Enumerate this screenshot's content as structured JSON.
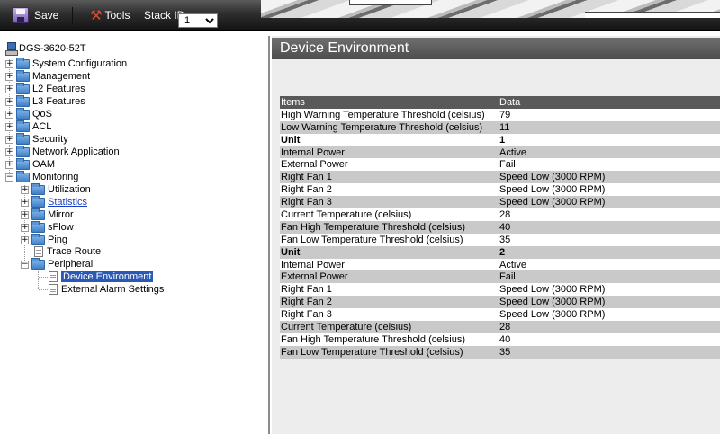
{
  "toolbar": {
    "save_label": "Save",
    "tools_label": "Tools",
    "stack_id_label": "Stack ID",
    "stack_id_value": "1"
  },
  "tree": {
    "root": "DGS-3620-52T",
    "items": [
      "System Configuration",
      "Management",
      "L2 Features",
      "L3 Features",
      "QoS",
      "ACL",
      "Security",
      "Network Application",
      "OAM",
      "Monitoring"
    ],
    "monitoring_children": [
      "Utilization",
      "Statistics",
      "Mirror",
      "sFlow",
      "Ping",
      "Trace Route",
      "Peripheral"
    ],
    "peripheral_children": [
      "Device Environment",
      "External Alarm Settings"
    ]
  },
  "content": {
    "title": "Device Environment",
    "table": {
      "headers": [
        "Items",
        "Data"
      ],
      "rows": [
        {
          "item": "High Warning Temperature Threshold (celsius)",
          "data": "79"
        },
        {
          "item": "Low Warning Temperature Threshold (celsius)",
          "data": "11"
        },
        {
          "item": "Unit",
          "data": "1"
        },
        {
          "item": "Internal Power",
          "data": "Active"
        },
        {
          "item": "External Power",
          "data": "Fail"
        },
        {
          "item": "Right Fan 1",
          "data": "Speed Low (3000 RPM)"
        },
        {
          "item": "Right Fan 2",
          "data": "Speed Low (3000 RPM)"
        },
        {
          "item": "Right Fan 3",
          "data": "Speed Low (3000 RPM)"
        },
        {
          "item": "Current Temperature (celsius)",
          "data": "28"
        },
        {
          "item": "Fan High Temperature Threshold (celsius)",
          "data": "40"
        },
        {
          "item": "Fan Low Temperature Threshold (celsius)",
          "data": "35"
        },
        {
          "item": "Unit",
          "data": "2"
        },
        {
          "item": "Internal Power",
          "data": "Active"
        },
        {
          "item": "External Power",
          "data": "Fail"
        },
        {
          "item": "Right Fan 1",
          "data": "Speed Low (3000 RPM)"
        },
        {
          "item": "Right Fan 2",
          "data": "Speed Low (3000 RPM)"
        },
        {
          "item": "Right Fan 3",
          "data": "Speed Low (3000 RPM)"
        },
        {
          "item": "Current Temperature (celsius)",
          "data": "28"
        },
        {
          "item": "Fan High Temperature Threshold (celsius)",
          "data": "40"
        },
        {
          "item": "Fan Low Temperature Threshold (celsius)",
          "data": "35"
        }
      ]
    }
  },
  "colors": {
    "selected_node": "#2a59b5",
    "link": "#1a3cc4",
    "header_row": "#595959",
    "alt_row": "#c9c9c9"
  }
}
